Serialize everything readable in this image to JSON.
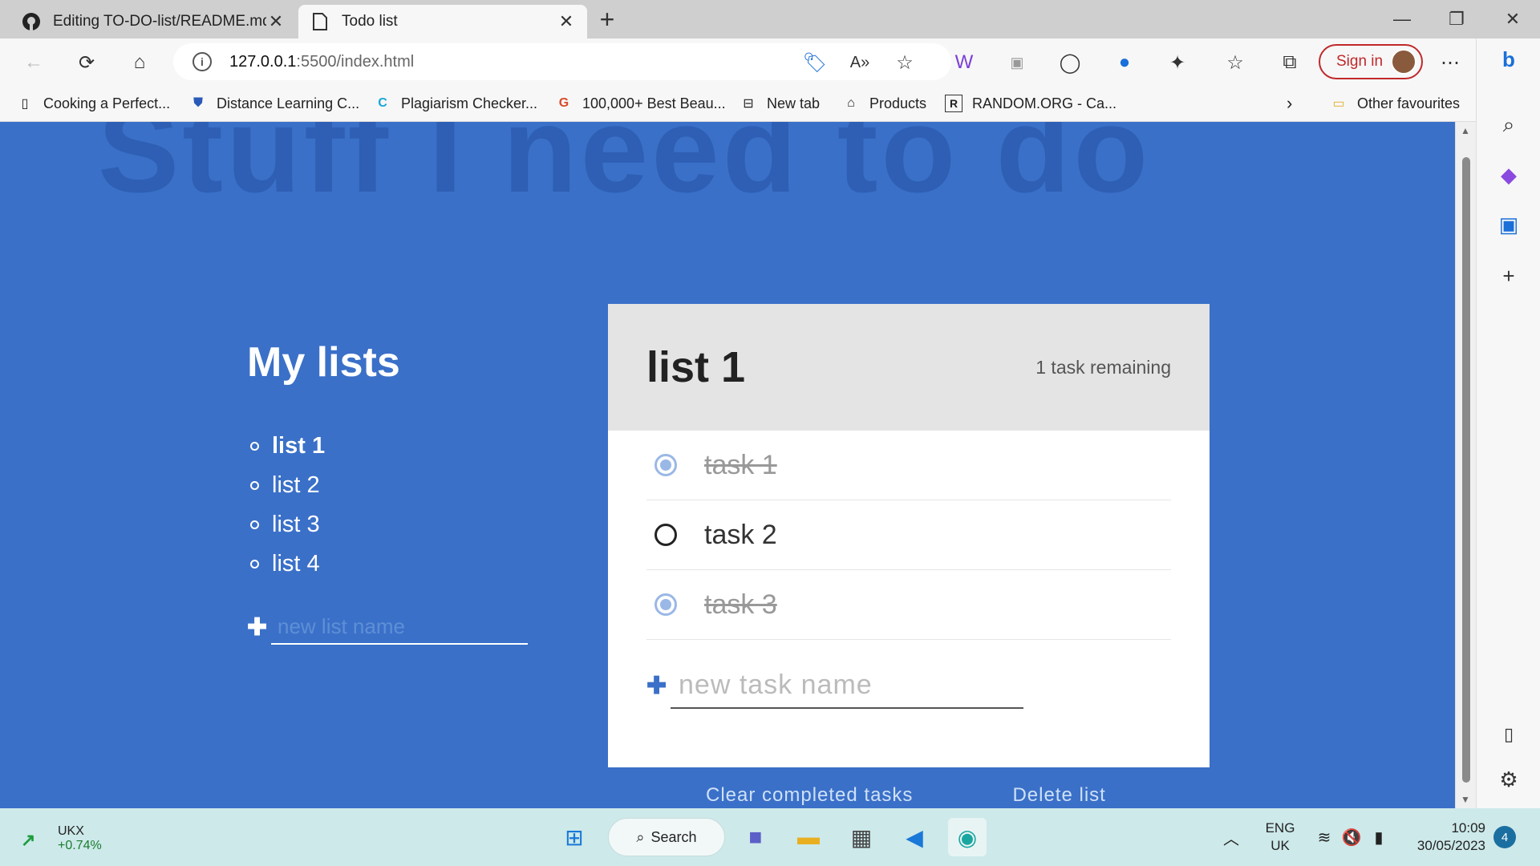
{
  "browser": {
    "tabs": [
      {
        "title": "Editing TO-DO-list/README.md",
        "icon": "github-icon",
        "active": false
      },
      {
        "title": "Todo list",
        "icon": "page-icon",
        "active": true
      }
    ],
    "address": {
      "host": "127.0.0.1",
      "path": ":5500/index.html"
    },
    "sign_in_label": "Sign in",
    "bookmarks": [
      {
        "label": "Cooking a Perfect...",
        "icon": "page-icon"
      },
      {
        "label": "Distance Learning C...",
        "icon": "shield-icon"
      },
      {
        "label": "Plagiarism Checker...",
        "icon": "c-logo-icon"
      },
      {
        "label": "100,000+ Best Beau...",
        "icon": "google-icon"
      },
      {
        "label": "New tab",
        "icon": "newtab-icon"
      },
      {
        "label": "Products",
        "icon": "store-icon"
      },
      {
        "label": "RANDOM.ORG - Ca...",
        "icon": "r-logo-icon"
      }
    ],
    "other_favourites": "Other favourites"
  },
  "app": {
    "background_title": "Stuff I need to do",
    "lists_heading": "My lists",
    "lists": [
      {
        "name": "list 1",
        "active": true
      },
      {
        "name": "list 2",
        "active": false
      },
      {
        "name": "list 3",
        "active": false
      },
      {
        "name": "list 4",
        "active": false
      }
    ],
    "new_list_placeholder": "new list name",
    "todo": {
      "title": "list 1",
      "remaining": "1 task remaining",
      "tasks": [
        {
          "name": "task 1",
          "done": true
        },
        {
          "name": "task 2",
          "done": false
        },
        {
          "name": "task 3",
          "done": true
        }
      ],
      "new_task_placeholder": "new task name"
    },
    "actions": {
      "clear": "Clear completed tasks",
      "delete": "Delete list"
    },
    "colors": {
      "background": "#3a70c8",
      "accent": "#3a70c8"
    }
  },
  "taskbar": {
    "ticker": {
      "symbol": "UKX",
      "change": "+0.74%"
    },
    "search_label": "Search",
    "lang": {
      "line1": "ENG",
      "line2": "UK"
    },
    "time": "10:09",
    "date": "30/05/2023",
    "notifications": "4"
  }
}
